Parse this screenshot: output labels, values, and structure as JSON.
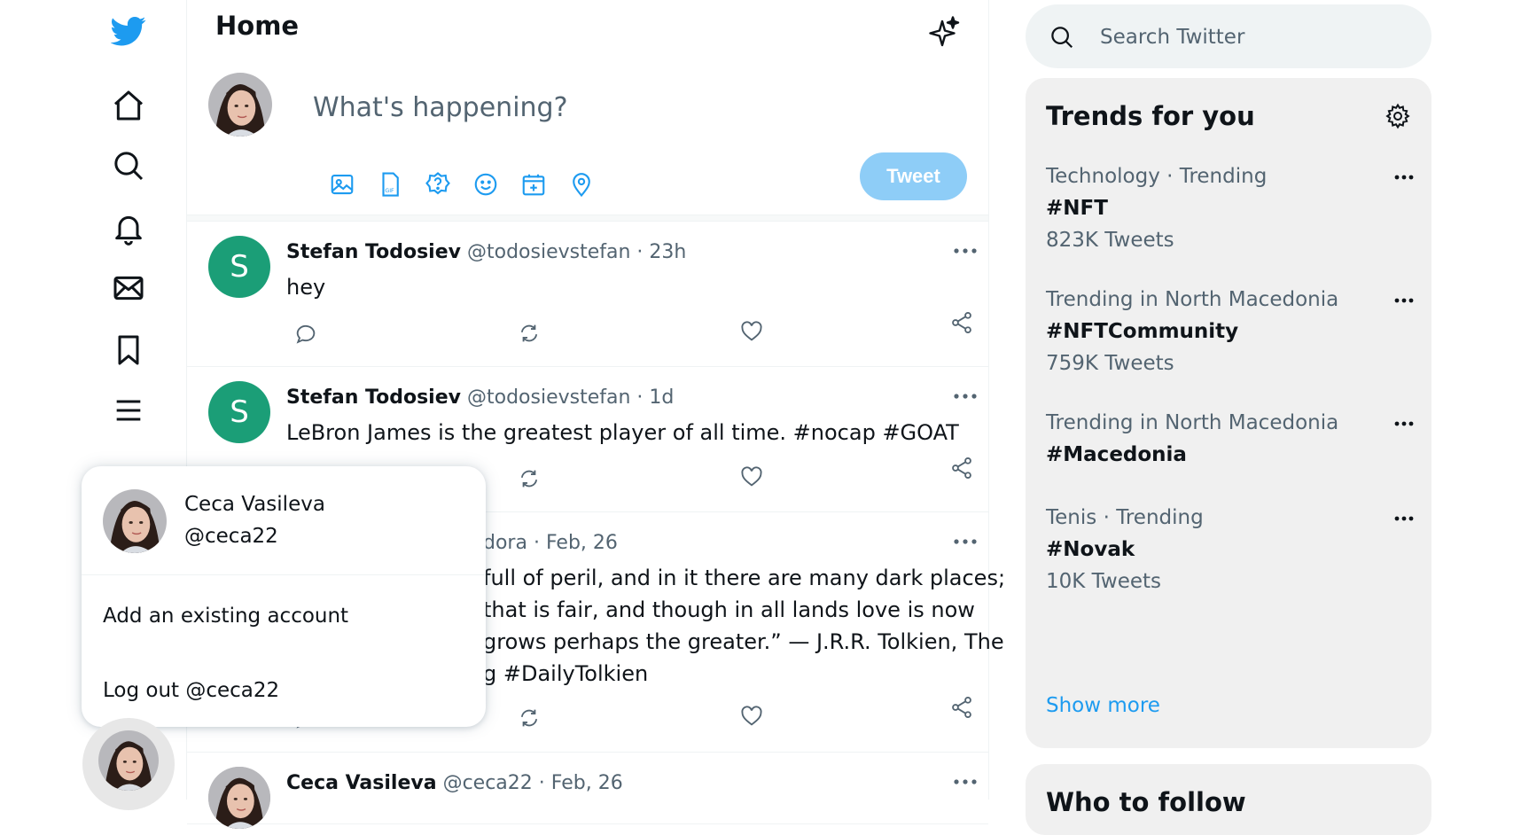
{
  "header": {
    "title": "Home"
  },
  "compose": {
    "placeholder": "What's happening?",
    "tweet_label": "Tweet"
  },
  "tweets": [
    {
      "name": "Stefan Todosiev",
      "handle": "@todosievstefan",
      "time": "23h",
      "avatar_letter": "S",
      "text": [
        "hey"
      ]
    },
    {
      "name": "Stefan Todosiev",
      "handle": "@todosievstefan",
      "time": "1d",
      "avatar_letter": "S",
      "text": [
        "LeBron James is the greatest player of all time.  #nocap #GOAT"
      ]
    },
    {
      "handle_partial": "dora",
      "time": "Feb, 26",
      "text": [
        "full of peril, and in it there are many dark places;",
        "that is fair, and though in all lands love is now",
        "grows perhaps the greater.” — J.R.R. Tolkien, The",
        "g #DailyTolkien"
      ]
    },
    {
      "name": "Ceca Vasileva",
      "handle": "@ceca22",
      "time": "Feb, 26"
    }
  ],
  "search": {
    "placeholder": "Search Twitter"
  },
  "trends": {
    "title": "Trends for you",
    "items": [
      {
        "category": "Technology",
        "label": "Trending",
        "tag": "#NFT",
        "count": "823K Tweets"
      },
      {
        "category": "Trending in North Macedonia",
        "tag": "#NFTCommunity",
        "count": "759K Tweets"
      },
      {
        "category": "Trending in North Macedonia",
        "tag": "#Macedonia"
      },
      {
        "category": "Tenis",
        "label": "Trending",
        "tag": "#Novak",
        "count": "10K Tweets"
      }
    ],
    "show_more": "Show more"
  },
  "who_to_follow": {
    "title": "Who to follow"
  },
  "account_menu": {
    "name": "Ceca Vasileva",
    "handle": "@ceca22",
    "add_account": "Add an existing account",
    "logout": "Log out @ceca22"
  },
  "colors": {
    "accent": "#1d9bf0",
    "tweet_button": "#8ecdf7",
    "avatar_green": "#1b9e77"
  }
}
